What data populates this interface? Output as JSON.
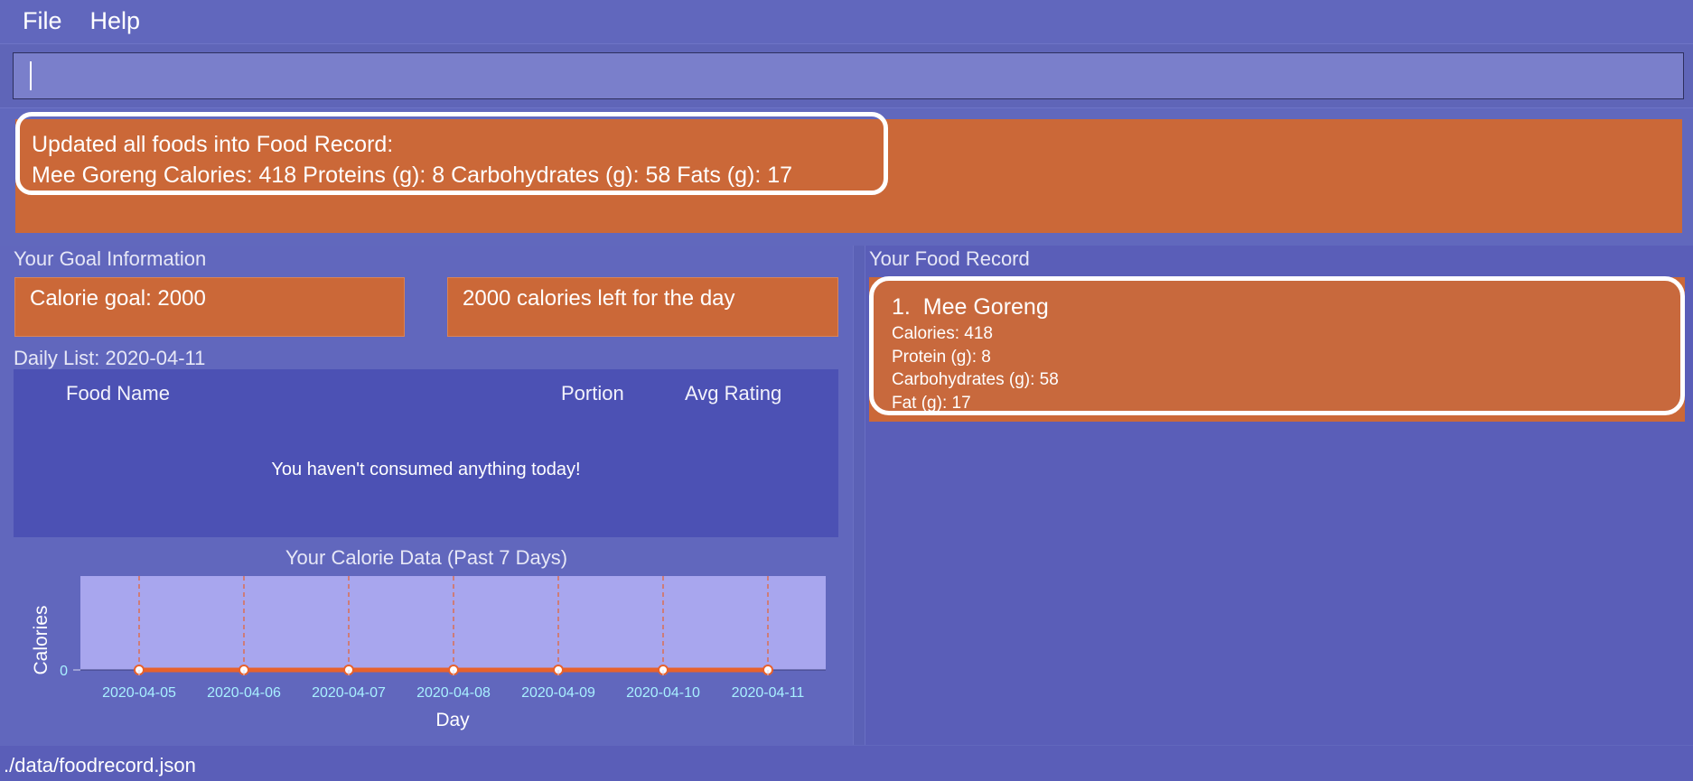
{
  "menu": {
    "file": "File",
    "help": "Help"
  },
  "command": {
    "value": "",
    "placeholder": ""
  },
  "result": {
    "line1": "Updated all foods into Food Record:",
    "line2": "Mee Goreng Calories: 418 Proteins (g): 8 Carbohydrates (g): 58 Fats (g): 17"
  },
  "goal": {
    "title": "Your Goal Information",
    "calorie_goal": "Calorie goal: 2000",
    "calories_left": "2000 calories left for the day"
  },
  "daily": {
    "title": "Daily List: 2020-04-11",
    "columns": [
      "Food Name",
      "Portion",
      "Avg Rating"
    ],
    "empty_message": "You haven't consumed anything today!"
  },
  "chart_data": {
    "type": "line",
    "title": "Your Calorie Data (Past 7 Days)",
    "xlabel": "Day",
    "ylabel": "Calories",
    "categories": [
      "2020-04-05",
      "2020-04-06",
      "2020-04-07",
      "2020-04-08",
      "2020-04-09",
      "2020-04-10",
      "2020-04-11"
    ],
    "values": [
      0,
      0,
      0,
      0,
      0,
      0,
      0
    ],
    "yticks": [
      "0"
    ],
    "grid": "vertical",
    "colors": {
      "plot_bg": "#a8a6ee",
      "line": "#e8612c",
      "grid": "#e8612c",
      "tick_text": "#a8f0ff"
    }
  },
  "food_record": {
    "title": "Your Food Record",
    "items": [
      {
        "index": "1.",
        "name": "Mee Goreng",
        "calories": "Calories: 418",
        "protein": "Protein (g): 8",
        "carbs": "Carbohydrates (g): 58",
        "fat": "Fat (g): 17"
      }
    ]
  },
  "status": {
    "path": "./data/foodrecord.json"
  },
  "colors": {
    "background": "#6167bd",
    "accent": "#cb6838",
    "table_bg": "#4c51b4"
  }
}
